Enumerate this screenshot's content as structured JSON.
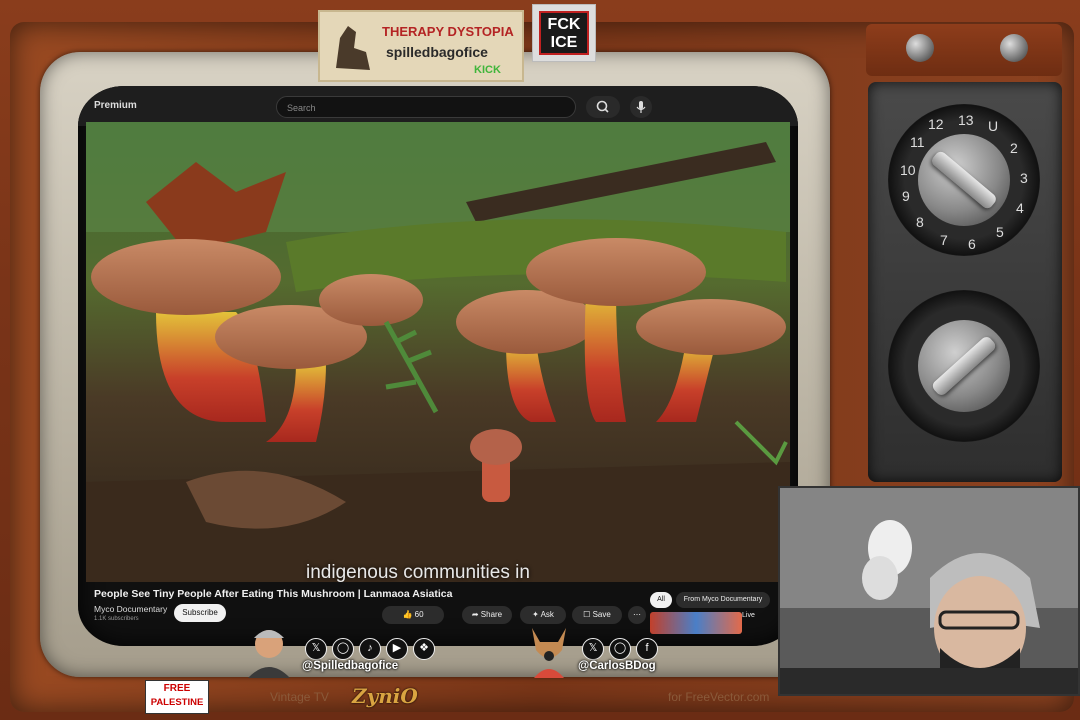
{
  "youtube": {
    "logo_text": "Premium",
    "search_placeholder": "Search",
    "video_caption": "indigenous communities in",
    "video_title": "People See Tiny People After Eating This Mushroom | Lanmaoa Asiatica",
    "channel_name": "Myco Documentary",
    "channel_subs": "1.1K subscribers",
    "subscribe_label": "Subscribe",
    "like_count": "60",
    "share_label": "Share",
    "ask_label": "Ask",
    "save_label": "Save",
    "more_label": "⋯",
    "chips": [
      "All",
      "From Myco Documentary"
    ],
    "live_label": "Live"
  },
  "stickers": {
    "therapy_line1": "THERAPY DYSTOPIA",
    "therapy_line2": "spilledbagofice",
    "therapy_line3": "KICK",
    "fck_ice": "FCK ICE"
  },
  "dial_numbers_top": [
    "12",
    "13",
    "U",
    "2",
    "3",
    "4",
    "5",
    "6",
    "7",
    "8",
    "9",
    "10",
    "11"
  ],
  "socials": {
    "left_handle": "@Spilledbagofice",
    "left_icons": [
      "twitter-icon",
      "instagram-icon",
      "tiktok-icon",
      "youtube-icon",
      "bluesky-icon"
    ],
    "right_handle": "@CarlosBDog",
    "right_icons": [
      "twitter-icon",
      "instagram-icon",
      "facebook-icon"
    ]
  },
  "footer": {
    "free_palestine_line1": "FREE",
    "free_palestine_line2": "PALESTINE",
    "brand_label": "Vintage TV",
    "brand_name": "ZyniO",
    "credit": "for FreeVector.com"
  },
  "colors": {
    "cabinet": "#7a3418",
    "bezel": "#c8c1b1",
    "accent_red": "#c02020",
    "kick_green": "#3fb53a"
  }
}
